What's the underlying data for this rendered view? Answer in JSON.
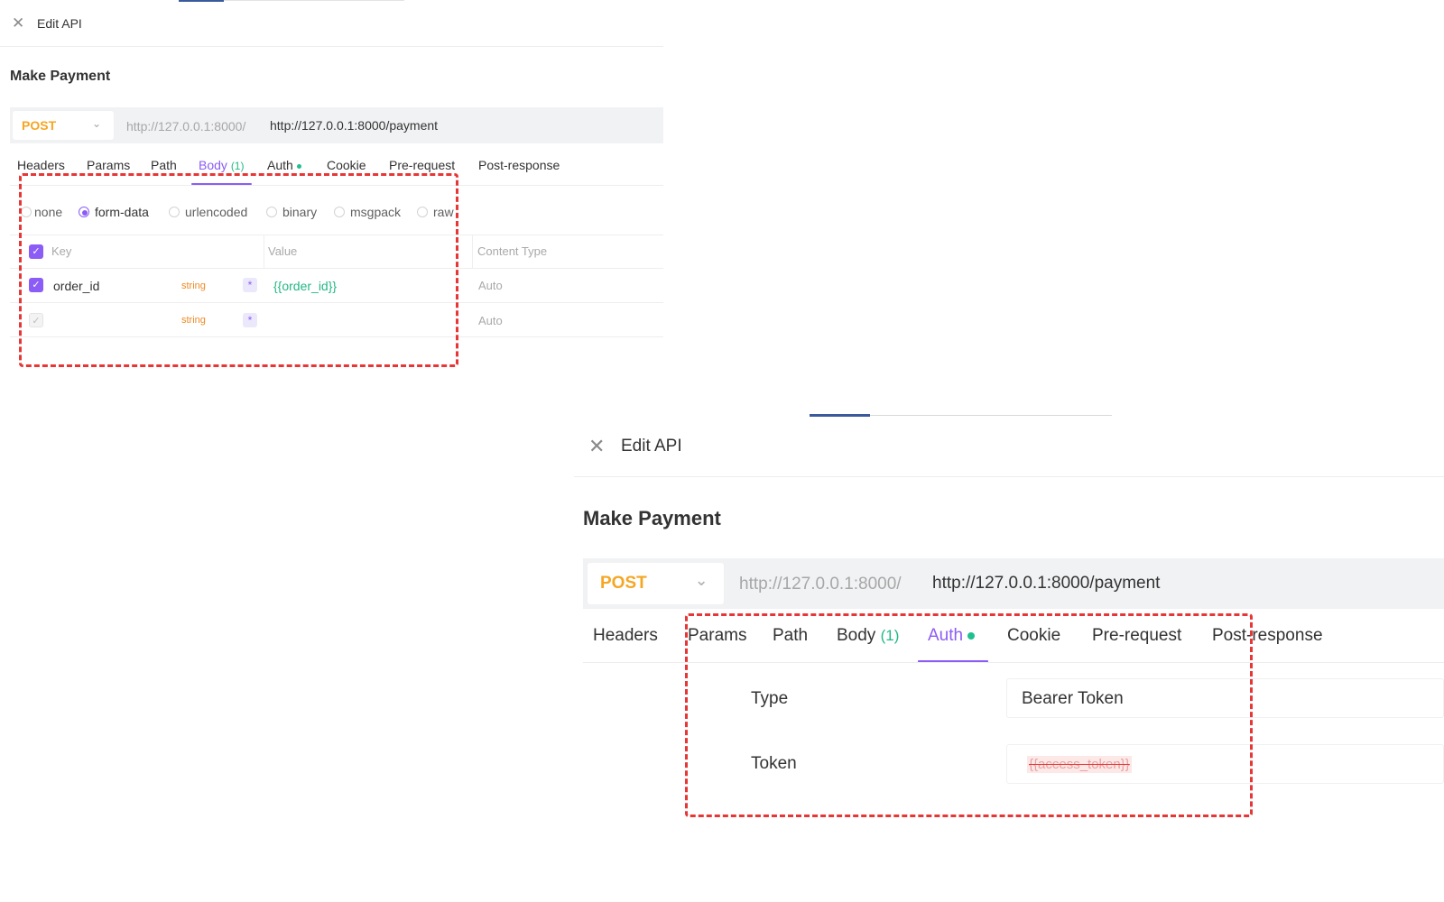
{
  "panel1": {
    "close_icon": "close-icon",
    "title": "Edit API",
    "api_name": "Make Payment",
    "method": "POST",
    "base_url": "http://127.0.0.1:8000/",
    "url": "http://127.0.0.1:8000/payment",
    "tabs": [
      {
        "label": "Headers"
      },
      {
        "label": "Params"
      },
      {
        "label": "Path"
      },
      {
        "label": "Body",
        "count": "(1)"
      },
      {
        "label": "Auth"
      },
      {
        "label": "Cookie"
      },
      {
        "label": "Pre-request"
      },
      {
        "label": "Post-response"
      }
    ],
    "active_tab": "Body",
    "body_types": [
      "none",
      "form-data",
      "urlencoded",
      "binary",
      "msgpack",
      "raw"
    ],
    "selected_body_type": "form-data",
    "table": {
      "headers": {
        "key": "Key",
        "value": "Value",
        "content_type": "Content Type"
      },
      "rows": [
        {
          "checked": true,
          "key": "order_id",
          "type": "string",
          "required": "*",
          "value": "{{order_id}}",
          "content_type": "Auto"
        },
        {
          "checked": false,
          "key": "",
          "type": "string",
          "required": "*",
          "value": "",
          "content_type": "Auto"
        }
      ]
    }
  },
  "panel2": {
    "close_icon": "close-icon",
    "title": "Edit API",
    "api_name": "Make Payment",
    "method": "POST",
    "base_url": "http://127.0.0.1:8000/",
    "url": "http://127.0.0.1:8000/payment",
    "tabs": [
      {
        "label": "Headers"
      },
      {
        "label": "Params"
      },
      {
        "label": "Path"
      },
      {
        "label": "Body",
        "count": "(1)"
      },
      {
        "label": "Auth"
      },
      {
        "label": "Cookie"
      },
      {
        "label": "Pre-request"
      },
      {
        "label": "Post-response"
      }
    ],
    "active_tab": "Auth",
    "auth": {
      "type_label": "Type",
      "type_value": "Bearer Token",
      "token_label": "Token",
      "token_value": "{{access_token}}"
    }
  },
  "colors": {
    "accent": "#8b5cf6",
    "method": "#f5a623",
    "variable": "#23b883",
    "highlight_box": "#e63636"
  }
}
